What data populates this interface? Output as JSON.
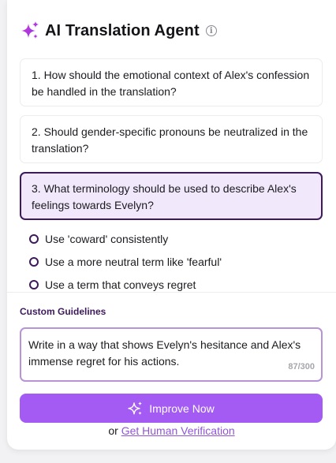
{
  "header": {
    "title": "AI Translation Agent",
    "info_glyph": "i"
  },
  "questions": [
    {
      "text": "1. How should the emotional context of Alex's confession be handled in the translation?",
      "selected": false
    },
    {
      "text": "2. Should gender-specific pronouns be neutralized in the translation?",
      "selected": false
    },
    {
      "text": "3. What terminology should be used to describe Alex's feelings towards Evelyn?",
      "selected": true
    }
  ],
  "options": [
    "Use 'coward' consistently",
    "Use a more neutral term like 'fearful'",
    "Use a term that conveys regret"
  ],
  "custom_guidelines": {
    "label": "Custom Guidelines",
    "value": "Write in a way that shows Evelyn's hesitance and Alex's immense regret for his actions.",
    "counter": "87/300"
  },
  "actions": {
    "improve_label": "Improve Now",
    "or_text": "or",
    "human_verification_label": "Get Human Verification"
  },
  "colors": {
    "accent": "#a35bf3",
    "selected_border": "#3d1a5c",
    "selected_bg": "#f1e8fc",
    "link": "#9155d8"
  },
  "icons": {
    "header": "sparkle-icon",
    "info": "info-icon",
    "button": "sparkle-icon"
  }
}
